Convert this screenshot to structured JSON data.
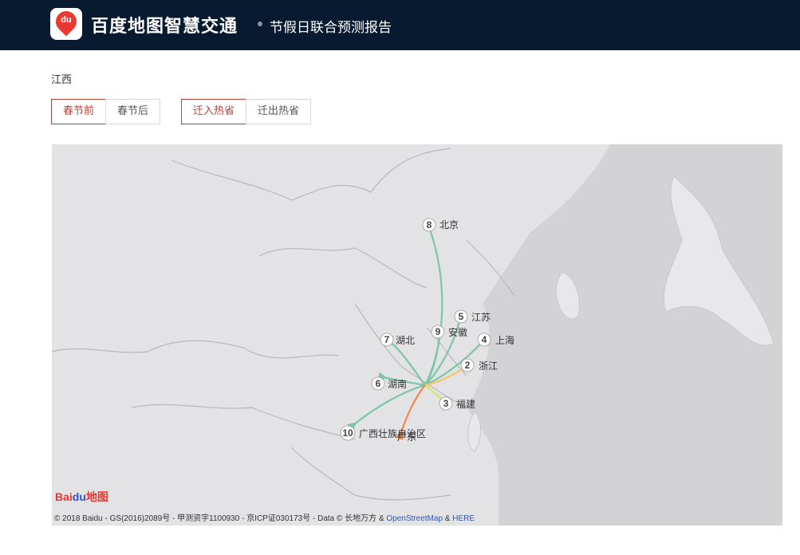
{
  "header": {
    "logo_text": "du",
    "brand": "百度地图智慧交通",
    "subtitle": "节假日联合预测报告"
  },
  "province": "江西",
  "period_tabs": [
    {
      "label": "春节前",
      "active": true
    },
    {
      "label": "春节后",
      "active": false
    }
  ],
  "direction_tabs": [
    {
      "label": "迁入热省",
      "active": true
    },
    {
      "label": "迁出热省",
      "active": false
    }
  ],
  "map": {
    "center": "江西",
    "places": [
      {
        "rank": "8",
        "name": "北京",
        "color": "#7cc6a6"
      },
      {
        "rank": "5",
        "name": "江苏",
        "color": "#7cc6a6"
      },
      {
        "rank": "9",
        "name": "安徽",
        "color": "#7cc6a6"
      },
      {
        "rank": "7",
        "name": "湖北",
        "color": "#7cc6a6"
      },
      {
        "rank": "4",
        "name": "上海",
        "color": "#7cc6a6"
      },
      {
        "rank": "2",
        "name": "浙江",
        "color": "#f5c36a"
      },
      {
        "rank": "6",
        "name": "湖南",
        "color": "#7cc6a6"
      },
      {
        "rank": "3",
        "name": "福建",
        "color": "#d6e35e"
      },
      {
        "rank": "10",
        "name": "广西壮族自治区",
        "color": "#7cc6a6"
      },
      {
        "rank": "1",
        "name": "广东",
        "color": "#f08a4b"
      }
    ],
    "logo_text": {
      "part1": "Bai",
      "part2": "du",
      "part3": "地图"
    },
    "copyright": {
      "text": "© 2018 Baidu - GS(2016)2089号 - 甲测资字1100930 - 京ICP证030173号 - Data © 长地万方 & ",
      "osm": "OpenStreetMap",
      "amp": " & ",
      "here": "HERE"
    }
  }
}
